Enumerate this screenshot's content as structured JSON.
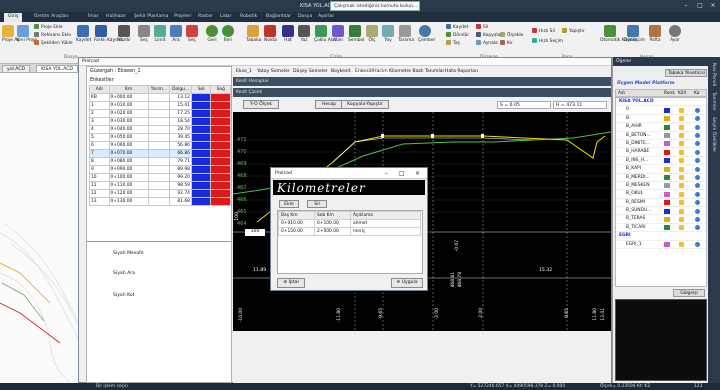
{
  "titlebar": {
    "title": "KISA YOL.ACD - Prolcad 2021",
    "search_placeholder": "Çalışmak istediğiniz komutu bulun..."
  },
  "ribbon_tabs": [
    "Giriş",
    "Üretim Araçları",
    "İmar",
    "Halihazır",
    "Şehir Planlama",
    "Projeler",
    "Raster",
    "Lidar",
    "Robotik",
    "Bağlantılar",
    "Dosya",
    "Ayarlar"
  ],
  "ribbon": {
    "proje": "Proje Aç",
    "yeni": "Yeni Proje",
    "proje_ekle": "Proje Ekle",
    "referans": "Referans Ekle",
    "sekil": "Şekilden Yükle",
    "kaydet": "Kaydet",
    "farkli": "Farklı Kaydet",
    "yazdir": "Yazdır",
    "sec": "Seç",
    "limit": "Limit",
    "ara": "Ara",
    "sec2": "Seç",
    "geri": "Geri",
    "ileri": "İleri",
    "tabaka": "Tabaka",
    "nokta": "Nokta",
    "hat": "Hat",
    "yaz": "Yaz",
    "cokgen": "Çoklu Alan",
    "alan": "Alan",
    "sembol": "Sembol",
    "olc": "Ölç",
    "yay": "Yay",
    "tarama": "Tarama",
    "cember": "Çember",
    "kaydet2": "Kaydet",
    "sil": "Sil",
    "dondur": "Döndür",
    "kopyala": "Kopyala",
    "tas": "Taş",
    "ayna": "Aynala",
    "olcekle": "Ölçekle",
    "kir": "Kır",
    "hizli_sil": "Hızlı Sil",
    "hizli_secim": "Hızlı Seçim",
    "yapistir": "Yapıştır",
    "otomatik": "Otomatik Kaydet",
    "donusum": "Dönüşüm",
    "pafta": "Pafta",
    "ayar": "Ayar",
    "grp_dosya": "Dosya",
    "grp_cizim": "Çizim",
    "grp_duzen": "Düzenle",
    "grp_pano": "Pano",
    "grp_hesap": "Hesap"
  },
  "doc_tabs": [
    "yol.ACD",
    "KISA YOL.ACD"
  ],
  "window": {
    "title": "Prolcad"
  },
  "left": {
    "guzergah": "Güzergah : Ekseen_1",
    "enkesitler": "Enkesitler",
    "headers": [
      "Adı",
      "Km",
      "Yarım...",
      "Dolgu...",
      "Sol",
      "Sağ"
    ],
    "rows": [
      [
        "KB",
        "0+000.00",
        "13.12"
      ],
      [
        "1",
        "0+010.00",
        "15.41"
      ],
      [
        "2",
        "0+020.00",
        "17.25"
      ],
      [
        "3",
        "0+030.00",
        "18.54"
      ],
      [
        "4",
        "0+040.00",
        "28.70"
      ],
      [
        "5",
        "0+050.00",
        "39.45"
      ],
      [
        "6",
        "0+060.00",
        "56.86"
      ],
      [
        "7",
        "0+070.00",
        "66.86"
      ],
      [
        "8",
        "0+080.00",
        "79.71"
      ],
      [
        "9",
        "0+090.00",
        "89.98"
      ],
      [
        "10",
        "0+100.00",
        "99.20"
      ],
      [
        "11",
        "0+110.00",
        "98.59"
      ],
      [
        "12",
        "0+120.00",
        "92.74"
      ],
      [
        "13",
        "0+130.00",
        "81.68"
      ]
    ],
    "siyah_mesafe": "Siyah Mesafe",
    "siyah_ara": "Siyah Ara",
    "siyah_kot": "Siyah Kot"
  },
  "profile": {
    "tabs": [
      "Ekse_1",
      "Yatay Someler",
      "Düşey Someler",
      "Boykesit",
      "Enkesit/Hacim",
      "Kilometre Bazlı Tanımlar",
      "Hata Raporları"
    ],
    "section_title": "Kesit Hesaplar",
    "kesit_cizimi": "Kesit Çizimi",
    "tool_yo": "Y-O Ölçek",
    "tool_hesap": "Hesap",
    "tool_kopya": "Kopyala-Yapıştır",
    "s_value": "S = 6.05",
    "h_value": "H = 473.11",
    "elev_labels": [
      "471",
      "470",
      "469",
      "468",
      "467",
      "466",
      "465",
      "464"
    ],
    "km_left": "100",
    "km_box": "100",
    "km_val1": "11.89",
    "km_val2": "15.32",
    "bottom_labels": [
      "-10.00",
      "-11.80",
      "-9.65",
      "-2.00",
      "2.00",
      "9.65",
      "11.80",
      "12.01"
    ],
    "mid_labels": [
      "468.81",
      "468.78",
      "-0.07"
    ]
  },
  "dialog": {
    "title": "Prolcad",
    "hero": "Kilometreler",
    "ekle": "Ekle",
    "sil": "Sil",
    "headers": [
      "Baş Km",
      "Sob Km",
      "Açıklama"
    ],
    "rows": [
      [
        "0+010.00",
        "0+100.00",
        "ahmet"
      ],
      [
        "0+150.00",
        "2+000.00",
        "meriç"
      ]
    ],
    "iptal": "İptal",
    "uygula": "Uygula"
  },
  "rpanel": {
    "title": "Öğeler",
    "tabaka": "Tabaka Yöneticisi",
    "model": "Üçgen Model Platform",
    "headers": [
      "Adı",
      "Renk",
      "Kilit",
      "Ka"
    ],
    "items": [
      "KISA YOL.ACD",
      "0",
      "B",
      "B_AHIR",
      "B_BETON...",
      "B_DINITE...",
      "B_HARABE",
      "B_INS_H...",
      "B_KAPI",
      "B_MERDI...",
      "B_MESKEN",
      "B_OKUL",
      "B_RESMI",
      "B_SUNDU...",
      "B_TERAS",
      "B_TICARI",
      "EGRI",
      "EGRI_1"
    ],
    "gölgesi": "Gölgeişi"
  },
  "strip": [
    "Nav Paneli",
    "Tanımlar",
    "Seçim Özellikler"
  ],
  "status": {
    "left": "Bir işlem seçin",
    "coords": "Y= 527246.657 X= 4490598.378 Z= 0.000",
    "scale": "Ölçek= 0.23594 Kt: K2",
    "zoom": "123"
  },
  "colors": {
    "accent": "#2b3a4a",
    "blue": "#1a2bd8",
    "red": "#e01818",
    "profile_green": "#4ec14a",
    "profile_yellow": "#f0e000"
  }
}
